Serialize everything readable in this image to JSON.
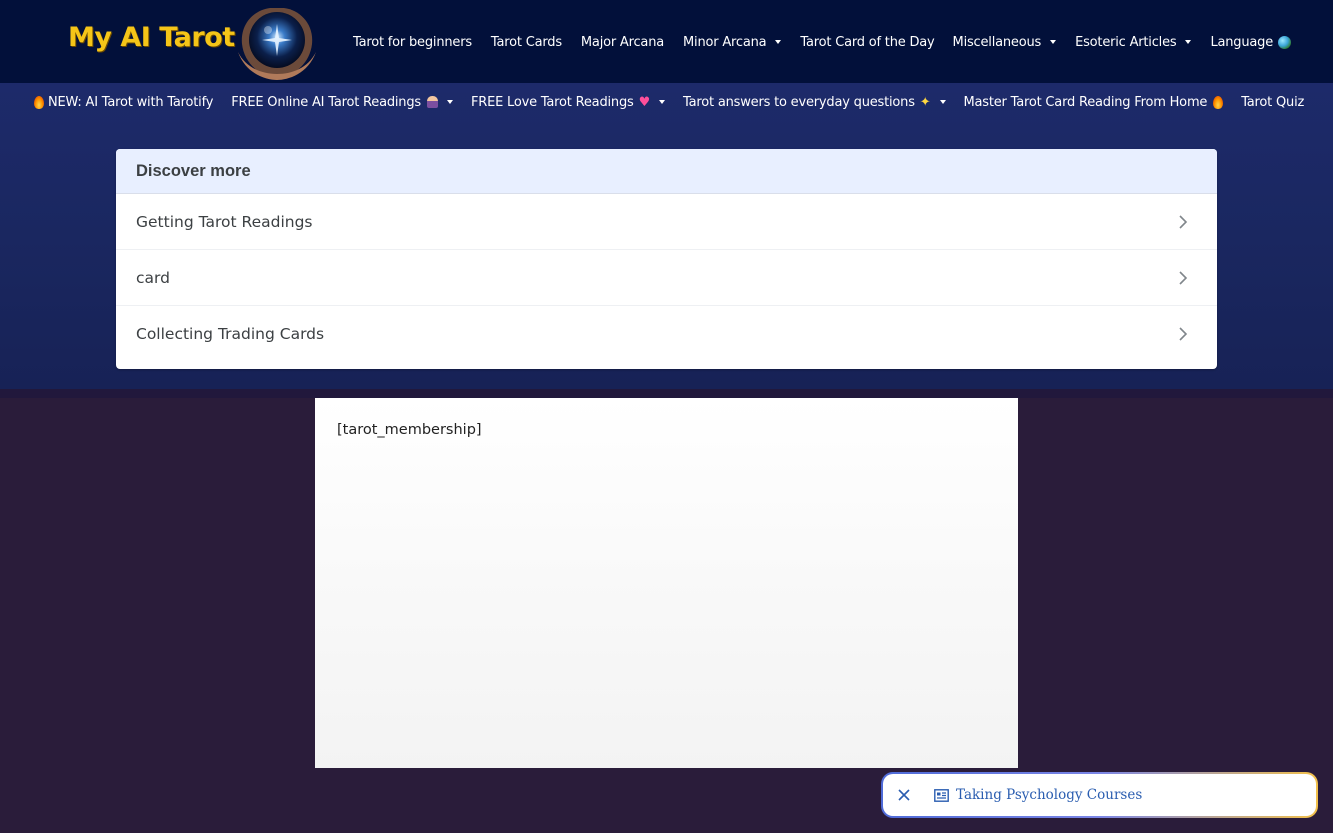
{
  "header": {
    "logo_text": "My AI Tarot",
    "nav": [
      {
        "label": "Tarot for beginners",
        "has_dropdown": false
      },
      {
        "label": "Tarot Cards",
        "has_dropdown": false
      },
      {
        "label": "Major Arcana",
        "has_dropdown": false
      },
      {
        "label": "Minor Arcana",
        "has_dropdown": true
      },
      {
        "label": "Tarot Card of the Day",
        "has_dropdown": false
      },
      {
        "label": "Miscellaneous",
        "has_dropdown": true
      },
      {
        "label": "Esoteric Articles",
        "has_dropdown": true
      },
      {
        "label": "Language",
        "has_dropdown": false,
        "icon": "globe-icon"
      }
    ]
  },
  "subnav": [
    {
      "label": "NEW: AI Tarot with Tarotify",
      "icon_before": "fire-icon"
    },
    {
      "label": "FREE Online AI Tarot Readings",
      "icon_after": "tarot-reader-icon",
      "has_dropdown": true
    },
    {
      "label": "FREE Love Tarot Readings",
      "icon_after": "heart-icon",
      "has_dropdown": true
    },
    {
      "label": "Tarot answers to everyday questions",
      "icon_after": "sparkle-icon",
      "has_dropdown": true
    },
    {
      "label": "Master Tarot Card Reading From Home",
      "icon_after": "fire-icon"
    },
    {
      "label": "Tarot Quiz"
    }
  ],
  "discover": {
    "title": "Discover more",
    "items": [
      {
        "label": "Getting Tarot Readings"
      },
      {
        "label": "card"
      },
      {
        "label": "Collecting Trading Cards"
      }
    ]
  },
  "content": {
    "shortcode": "[tarot_membership]"
  },
  "suggestion": {
    "label": "Taking Psychology Courses"
  },
  "colors": {
    "header_bg": "#02103a",
    "logo": "#f5c518",
    "discover_header_bg": "#e8efff",
    "link": "#2a5db0"
  }
}
